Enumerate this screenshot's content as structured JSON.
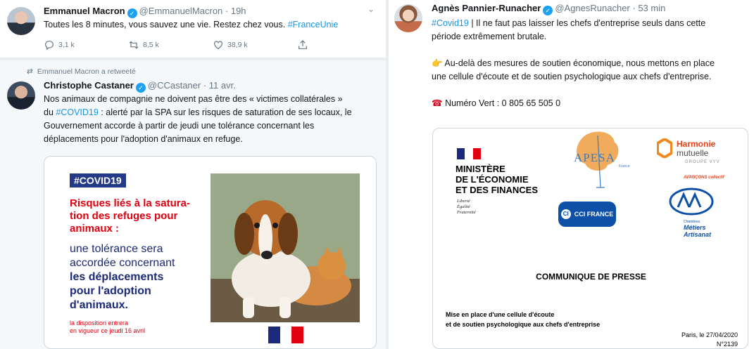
{
  "tweet_macron": {
    "name": "Emmanuel Macron",
    "handle": "@EmmanuelMacron",
    "time": "· 19h",
    "text": "Toutes les 8 minutes, vous sauvez une vie. Restez chez vous.",
    "hashtag": "#FranceUnie",
    "replies": "3,1 k",
    "retweets": "8,5 k",
    "likes": "38,9 k"
  },
  "retweet_context": {
    "text": "Emmanuel Macron a retweeté"
  },
  "tweet_castaner": {
    "name": "Christophe Castaner",
    "handle": "@CCastaner",
    "time": "· 11 avr.",
    "line1": "Nos animaux de compagnie ne doivent pas être des « victimes collatérales »",
    "line2_pre": "du",
    "hashtag": "#COVID19",
    "line2_post": ": alerté par la SPA sur les risques de saturation de ses locaux, le",
    "line3": "Gouvernement accorde à partir de jeudi une tolérance concernant les",
    "line4": "déplacements pour l'adoption d'animaux en refuge.",
    "card": {
      "tag": "#COVID19",
      "red_lines": [
        "Risques liés à la satura-",
        "tion des refuges pour",
        "animaux :"
      ],
      "blue_line1": "une tolérance sera",
      "blue_line2": "accordée concernant",
      "blue_bold1": "les déplacements",
      "blue_bold2": "pour l'adoption",
      "blue_bold3": "d'animaux.",
      "small1": "la disposition entrera",
      "small2": "en vigueur ce jeudi 16 avril"
    }
  },
  "tweet_apr": {
    "name": "Agnès Pannier-Runacher",
    "handle": "@AgnesRunacher",
    "time": "· 53 min",
    "hashtag": "#Covid19",
    "line1_post": "| Il ne faut pas laisser les chefs d'entreprise seuls dans cette",
    "line2": "période extrêmement brutale.",
    "point_emoji": "👉",
    "line3": "Au-delà des mesures de soutien économique, nous mettons en place",
    "line4": "une cellule d'écoute et de soutien psychologique aux chefs d'entreprise.",
    "phone_emoji": "☎",
    "line5": "Numéro Vert : 0 805 65 505 0",
    "card": {
      "ministry": [
        "MINISTÈRE",
        "DE L'ÉCONOMIE",
        "ET DES FINANCES"
      ],
      "motto": [
        "Liberté",
        "Égalité",
        "Fraternité"
      ],
      "apesa": "APESA",
      "apesa_sub": "France",
      "cci": "CCI FRANCE",
      "cci_mark": "CI",
      "harmonie1": "Harmonie",
      "harmonie2": "mutuelle",
      "harmonie3": "GROUPE VYV",
      "harmonie4": "AVANÇONS collectif",
      "cma_sub1": "Chambres",
      "cma_sub2a": "Métiers",
      "cma_sub2b": "Artisanat",
      "press": "COMMUNIQUE DE PRESSE",
      "mise1": "Mise en place d'une cellule d'écoute",
      "mise2": "et de soutien psychologique aux chefs d'entreprise",
      "paris": "Paris, le 27/04/2020",
      "number": "N°2139"
    }
  },
  "icons": {
    "verified": "✓",
    "chevron": "⌄",
    "retweet_small": "⇄"
  }
}
